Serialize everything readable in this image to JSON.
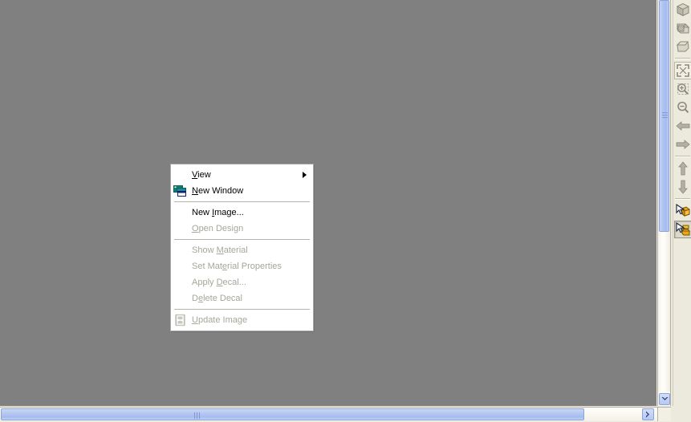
{
  "window": {
    "viewport_background": "#808080"
  },
  "context_menu": {
    "groups": [
      {
        "items": [
          {
            "label": "View",
            "accel_index": 0,
            "enabled": true,
            "submenu": true,
            "icon": "",
            "name": "menu-item-view"
          },
          {
            "label": "New Window",
            "accel_index": 0,
            "enabled": true,
            "submenu": false,
            "icon": "new-window-icon",
            "name": "menu-item-new-window"
          }
        ]
      },
      {
        "items": [
          {
            "label": "New Image...",
            "accel_index": 4,
            "enabled": true,
            "submenu": false,
            "icon": "",
            "name": "menu-item-new-image"
          },
          {
            "label": "Open Design",
            "accel_index": 0,
            "enabled": false,
            "submenu": false,
            "icon": "",
            "name": "menu-item-open-design"
          }
        ]
      },
      {
        "items": [
          {
            "label": "Show Material",
            "accel_index": 5,
            "enabled": false,
            "submenu": false,
            "icon": "",
            "name": "menu-item-show-material"
          },
          {
            "label": "Set Material Properties",
            "accel_index": 7,
            "enabled": false,
            "submenu": false,
            "icon": "",
            "name": "menu-item-set-material-properties"
          },
          {
            "label": "Apply Decal...",
            "accel_index": 6,
            "enabled": false,
            "submenu": false,
            "icon": "",
            "name": "menu-item-apply-decal"
          },
          {
            "label": "Delete Decal",
            "accel_index": 1,
            "enabled": false,
            "submenu": false,
            "icon": "",
            "name": "menu-item-delete-decal"
          }
        ]
      },
      {
        "items": [
          {
            "label": "Update Image",
            "accel_index": 0,
            "enabled": false,
            "submenu": false,
            "icon": "update-image-icon",
            "name": "menu-item-update-image"
          }
        ]
      }
    ]
  },
  "toolbar": {
    "buttons": [
      {
        "name": "render-wireframe-button",
        "icon": "shaded-cube-dotted-icon",
        "framed": false,
        "pressed": false
      },
      {
        "name": "render-textured-button",
        "icon": "shaded-cube-textured-icon",
        "framed": false,
        "pressed": false
      },
      {
        "name": "render-solid-button",
        "icon": "solid-shape-icon",
        "framed": false,
        "pressed": false
      },
      {
        "separator": true
      },
      {
        "name": "zoom-fit-button",
        "icon": "zoom-fit-icon",
        "framed": true,
        "pressed": false
      },
      {
        "name": "zoom-window-button",
        "icon": "zoom-in-marquee-icon",
        "framed": false,
        "pressed": false
      },
      {
        "name": "zoom-out-button",
        "icon": "zoom-out-icon",
        "framed": false,
        "pressed": false
      },
      {
        "name": "pan-left-button",
        "icon": "arrow-left-icon",
        "framed": false,
        "pressed": false
      },
      {
        "name": "pan-right-button",
        "icon": "arrow-right-icon",
        "framed": false,
        "pressed": false
      },
      {
        "separator": true
      },
      {
        "name": "pan-up-button",
        "icon": "arrow-up-icon",
        "framed": false,
        "pressed": false
      },
      {
        "name": "pan-down-button",
        "icon": "arrow-down-icon",
        "framed": false,
        "pressed": false
      },
      {
        "separator": true
      },
      {
        "name": "select-object-button",
        "icon": "cursor-cube-icon",
        "framed": false,
        "pressed": false
      },
      {
        "name": "select-surface-button",
        "icon": "cursor-surface-icon",
        "framed": false,
        "pressed": true
      }
    ]
  },
  "scrollbars": {
    "vertical": {
      "name": "vertical-scrollbar",
      "thumb_name": "vertical-scroll-thumb",
      "down_button_glyph": "▾"
    },
    "horizontal": {
      "name": "horizontal-scrollbar",
      "thumb_name": "horizontal-scroll-thumb",
      "right_button_glyph": "❯"
    }
  },
  "colors": {
    "canvas": "#808080",
    "menu_bg": "#ffffff",
    "menu_disabled_text": "#a6a69a",
    "scroll_thumb": "#aec3f0",
    "toolbar_bg": "#ece9dd"
  }
}
